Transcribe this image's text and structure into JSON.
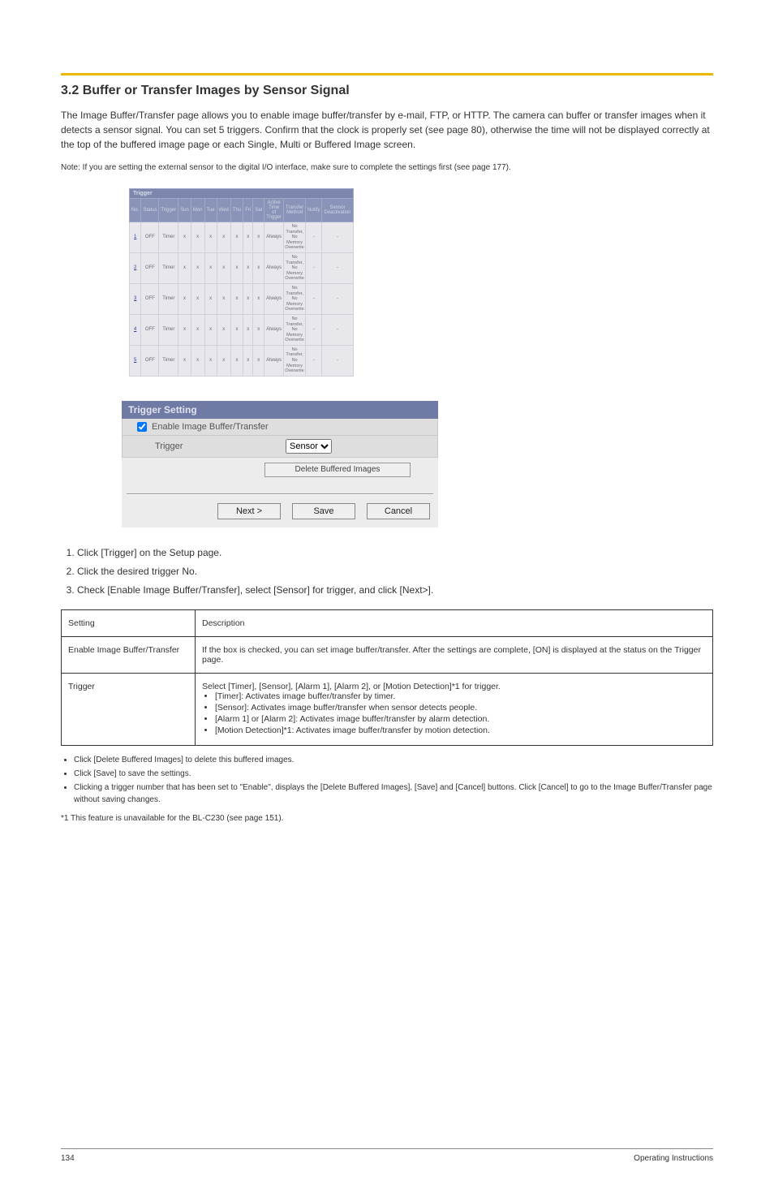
{
  "page_title": "3.2 Buffer or Transfer Images by Sensor Signal",
  "intro_paragraph": "The Image Buffer/Transfer page allows you to enable image buffer/transfer by e-mail, FTP, or HTTP. The camera can buffer or transfer images when it detects a sensor signal. You can set 5 triggers. Confirm that the clock is properly set (see page 80), otherwise the time will not be displayed correctly at the top of the buffered image page or each Single, Multi or Buffered Image screen.",
  "intro_note": "Note: If you are setting the external sensor to the digital I/O interface, make sure to complete the settings first (see page 177).",
  "shot1": {
    "caption": "Trigger",
    "headers": [
      "No.",
      "Status",
      "Trigger",
      "Sun",
      "Mon",
      "Tue",
      "Wed",
      "Thu",
      "Fri",
      "Sat",
      "Active Time of Trigger",
      "Transfer Method",
      "Notify",
      "Sensor Deactivation"
    ],
    "rows": [
      {
        "no": "1",
        "status": "OFF",
        "trigger": "Timer",
        "days": [
          "x",
          "x",
          "x",
          "x",
          "x",
          "x",
          "x"
        ],
        "active": "Always",
        "tmethod": "No Transfer, No Memory Overwrite",
        "notify": "-",
        "sensor": "-"
      },
      {
        "no": "2",
        "status": "OFF",
        "trigger": "Timer",
        "days": [
          "x",
          "x",
          "x",
          "x",
          "x",
          "x",
          "x"
        ],
        "active": "Always",
        "tmethod": "No Transfer, No Memory Overwrite",
        "notify": "-",
        "sensor": "-"
      },
      {
        "no": "3",
        "status": "OFF",
        "trigger": "Timer",
        "days": [
          "x",
          "x",
          "x",
          "x",
          "x",
          "x",
          "x"
        ],
        "active": "Always",
        "tmethod": "No Transfer, No Memory Overwrite",
        "notify": "-",
        "sensor": "-"
      },
      {
        "no": "4",
        "status": "OFF",
        "trigger": "Timer",
        "days": [
          "x",
          "x",
          "x",
          "x",
          "x",
          "x",
          "x"
        ],
        "active": "Always",
        "tmethod": "No Transfer, No Memory Overwrite",
        "notify": "-",
        "sensor": "-"
      },
      {
        "no": "5",
        "status": "OFF",
        "trigger": "Timer",
        "days": [
          "x",
          "x",
          "x",
          "x",
          "x",
          "x",
          "x"
        ],
        "active": "Always",
        "tmethod": "No Transfer, No Memory Overwrite",
        "notify": "-",
        "sensor": "-"
      }
    ]
  },
  "shot2": {
    "title": "Trigger Setting",
    "enable_label": "Enable Image Buffer/Transfer",
    "trigger_label": "Trigger",
    "trigger_select": "Sensor",
    "delete_btn": "Delete Buffered Images",
    "next_btn": "Next >",
    "save_btn": "Save",
    "cancel_btn": "Cancel"
  },
  "steps": [
    "Click [Trigger] on the Setup page.",
    "Click the desired trigger No.",
    "Check [Enable Image Buffer/Transfer], select [Sensor] for trigger, and click [Next>]."
  ],
  "settings_table": [
    {
      "setting": "Setting",
      "desc": "Description"
    },
    {
      "setting": "Enable Image Buffer/Transfer",
      "desc": "If the box is checked, you can set image buffer/transfer.\nAfter the settings are complete, [ON] is displayed at the status on the Trigger page."
    },
    {
      "setting": "Trigger",
      "desc_intro": "Select [Timer], [Sensor], [Alarm 1], [Alarm 2], or [Motion Detection]*1 for trigger.",
      "desc_bullets": [
        "[Timer]: Activates image buffer/transfer by timer.",
        "[Sensor]: Activates image buffer/transfer when sensor detects people.",
        "[Alarm 1] or [Alarm 2]: Activates image buffer/transfer by alarm detection.",
        "[Motion Detection]*1: Activates image buffer/transfer by motion detection."
      ]
    }
  ],
  "under_notes": [
    "Click [Delete Buffered Images] to delete this buffered images.",
    "Click [Save] to save the settings.",
    "Clicking a trigger number that has been set to \"Enable\", displays the [Delete Buffered Images], [Save] and [Cancel] buttons. Click [Cancel] to go to the Image Buffer/Transfer page without saving changes."
  ],
  "foot_star": "*1 This feature is unavailable for the BL-C230 (see page 151).",
  "footer_left": "Operating Instructions",
  "footer_page": "134"
}
